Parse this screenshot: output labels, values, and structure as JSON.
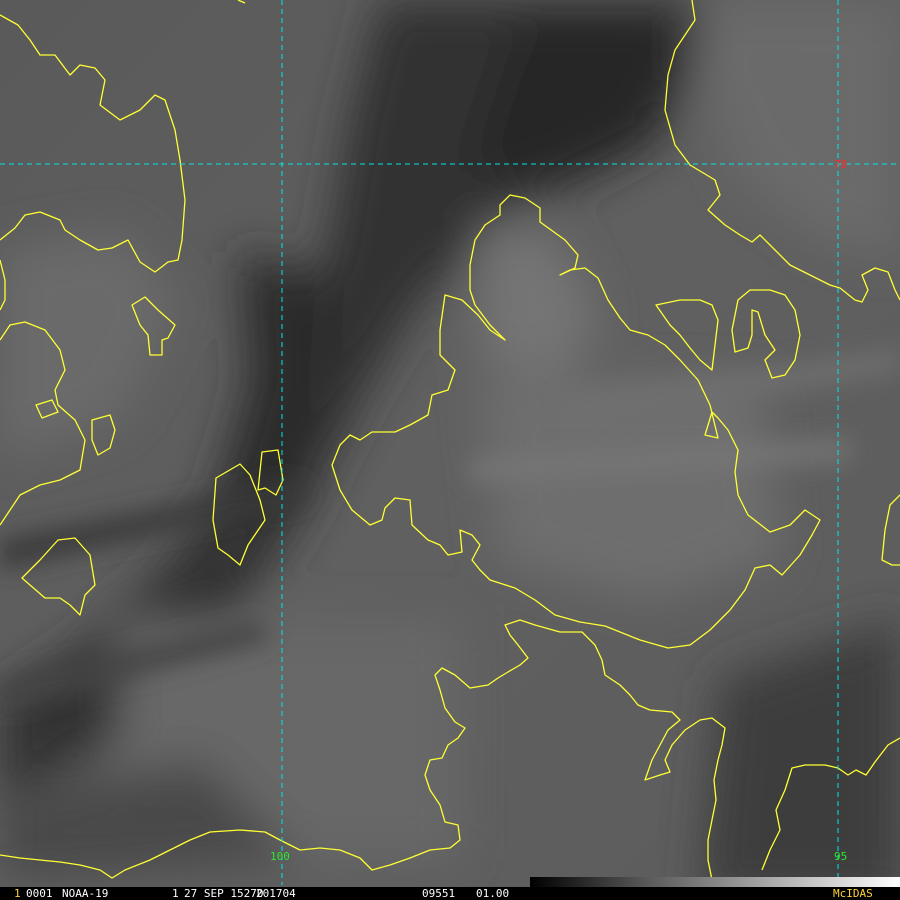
{
  "image": {
    "type": "satellite-imagery",
    "product": "McIDAS"
  },
  "grid": {
    "labels": {
      "lat_70": "70",
      "lon_100": "100",
      "lon_95": "95"
    },
    "line_color": "#00e5e5",
    "lat_label_color": "#ff2a2a",
    "lon_label_color": "#2ee62e"
  },
  "coastline": {
    "color": "#ffff33"
  },
  "status_bar": {
    "frame_number": "1",
    "frame_id": "0001",
    "satellite": "NOAA-19",
    "band": "1",
    "date": "27 SEP 15270",
    "julian": "201704",
    "time": "09551",
    "resolution": "01.00",
    "brand": "McIDAS"
  }
}
